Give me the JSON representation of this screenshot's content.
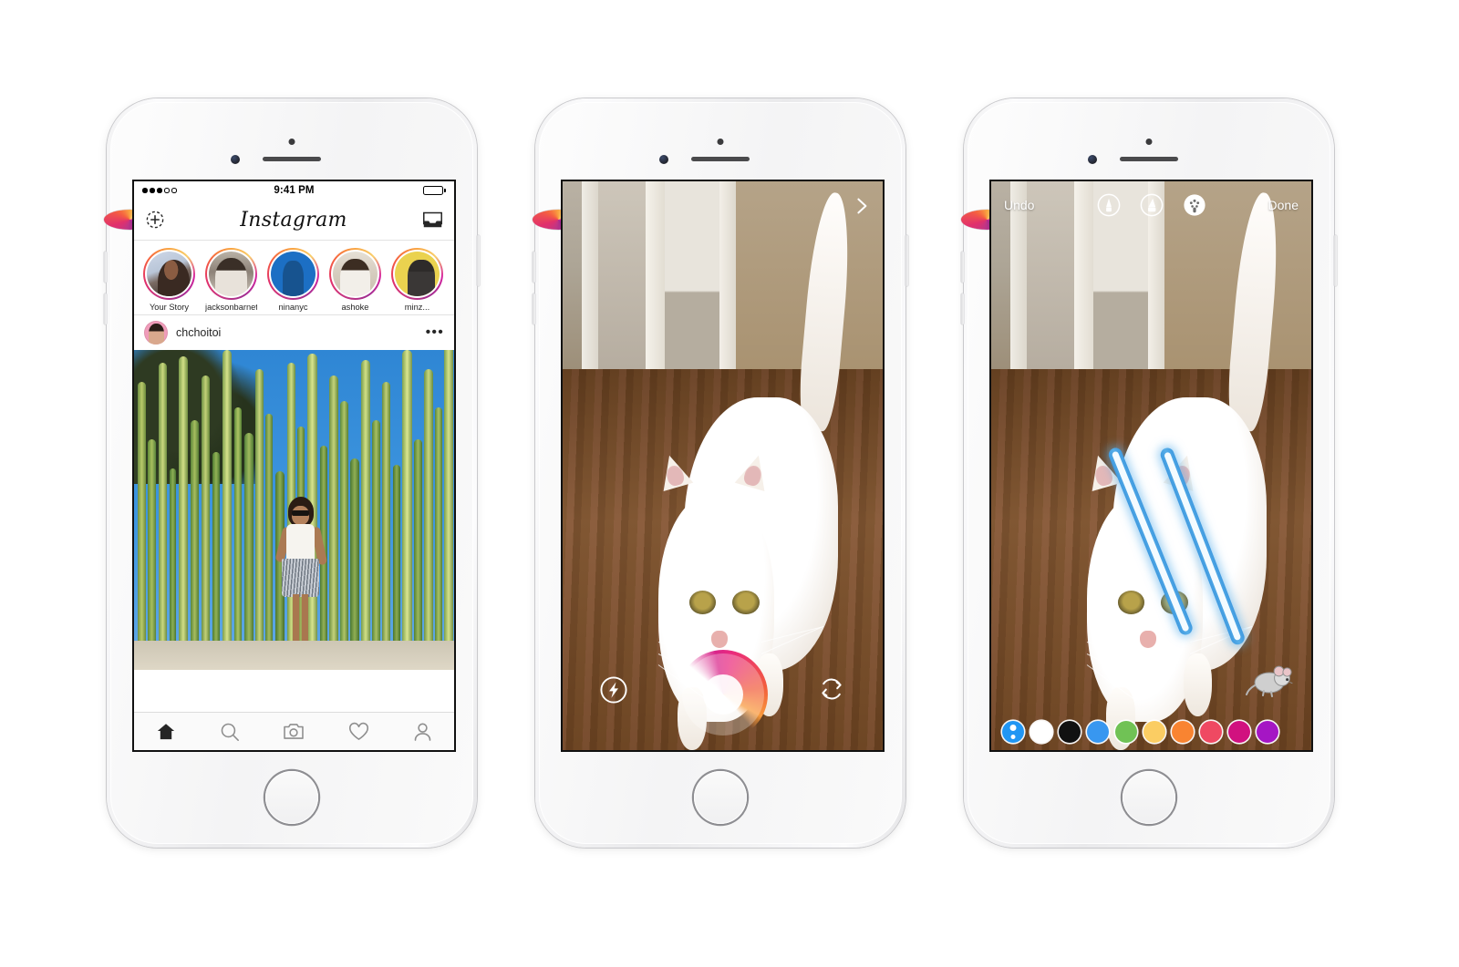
{
  "scene": {
    "background": "#ffffff",
    "device_count": 3,
    "device_label": "iPhone (silver/white)"
  },
  "phone1": {
    "app": "Instagram",
    "statusbar": {
      "signal": "3 of 5 bars",
      "time": "9:41 PM",
      "battery": "charged"
    },
    "navbar": {
      "left_icon": "add-story-camera-icon",
      "title": "Instagram",
      "right_icon": "direct-inbox-icon"
    },
    "stories": [
      {
        "name": "Your Story",
        "avatar": "av-a"
      },
      {
        "name": "jacksonbarnett",
        "avatar": "av-b"
      },
      {
        "name": "ninanyc",
        "avatar": "av-c"
      },
      {
        "name": "ashoke",
        "avatar": "av-d"
      },
      {
        "name": "minz...",
        "avatar": "av-e"
      }
    ],
    "post": {
      "username": "chchoitoi",
      "more_label": "•••",
      "image_alt": "Woman standing in front of tall cactus garden"
    },
    "tabbar": [
      {
        "id": "home",
        "icon": "home-icon",
        "active": true
      },
      {
        "id": "search",
        "icon": "search-icon",
        "active": false
      },
      {
        "id": "camera",
        "icon": "camera-icon",
        "active": false
      },
      {
        "id": "activity",
        "icon": "heart-icon",
        "active": false
      },
      {
        "id": "profile",
        "icon": "person-icon",
        "active": false
      }
    ],
    "story_ring_colors": [
      "#c13584",
      "#e1306c",
      "#f56040",
      "#f9a03f",
      "#f9cf6b"
    ]
  },
  "phone2": {
    "mode": "camera-capture",
    "next_icon": "chevron-right-icon",
    "controls": {
      "flash_icon": "flash-icon",
      "shutter_icon": "shutter-button",
      "flip_icon": "flip-camera-icon"
    },
    "shutter_gradient": [
      "#e9297f",
      "#f25d3c",
      "#f89a3c"
    ],
    "image_alt": "White cat walking on hardwood floor"
  },
  "phone3": {
    "mode": "draw-edit",
    "toolbar": {
      "undo_label": "Undo",
      "done_label": "Done",
      "pens": [
        {
          "id": "pen-marker",
          "icon": "marker-pen-icon",
          "selected": false
        },
        {
          "id": "pen-highlighter",
          "icon": "highlighter-pen-icon",
          "selected": false
        },
        {
          "id": "pen-neon",
          "icon": "neon-glow-pen-icon",
          "selected": true
        }
      ]
    },
    "palette": [
      {
        "id": "eyedropper",
        "color": "#2196f3",
        "icon": "eyedropper-icon"
      },
      {
        "id": "white",
        "color": "#ffffff"
      },
      {
        "id": "black",
        "color": "#111111"
      },
      {
        "id": "blue",
        "color": "#3897f0"
      },
      {
        "id": "green",
        "color": "#70c255"
      },
      {
        "id": "yellow",
        "color": "#fbcd63"
      },
      {
        "id": "orange",
        "color": "#f98431"
      },
      {
        "id": "red",
        "color": "#ef4962"
      },
      {
        "id": "pink",
        "color": "#d1117f"
      },
      {
        "id": "purple",
        "color": "#a516c4"
      }
    ],
    "drawing": {
      "type": "neon-laser-beams",
      "stroke_color": "#4fa3e3",
      "core_color": "#f4fbff",
      "count": 2
    },
    "sticker": "mouse-sticker",
    "image_alt": "White cat with drawn laser eyes and a mouse sticker"
  }
}
